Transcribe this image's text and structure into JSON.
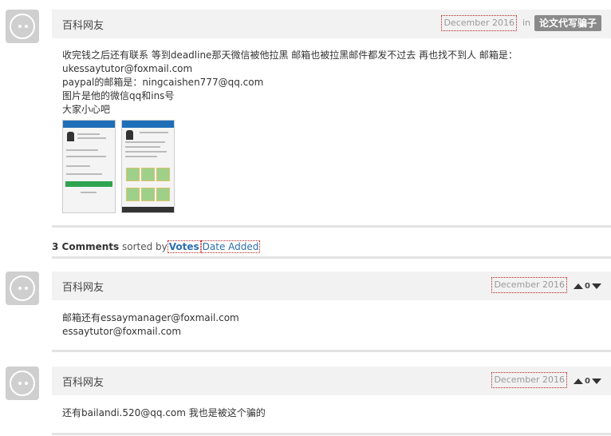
{
  "post": {
    "author": "百科网友",
    "date": "December 2016",
    "in_label": "in",
    "category": "论文代写骗子",
    "body_lines": [
      "收完钱之后还有联系 等到deadline那天微信被他拉黑 邮箱也被拉黑邮件都发不过去 再也找不到人 邮箱是：",
      "ukessaytutor@foxmail.com",
      "paypal的邮箱是：ningcaishen777@qq.com",
      "图片是他的微信qq和ins号",
      "大家小心吧"
    ]
  },
  "comments_header": {
    "count_label": "3 Comments",
    "sorted_by": "sorted by",
    "sort_votes": "Votes",
    "sort_date": "Date Added"
  },
  "comments": [
    {
      "author": "百科网友",
      "date": "December 2016",
      "votes": "0",
      "body_lines": [
        "邮箱还有essaymanager@foxmail.com",
        "essaytutor@foxmail.com"
      ]
    },
    {
      "author": "百科网友",
      "date": "December 2016",
      "votes": "0",
      "body_lines": [
        "还有bailandi.520@qq.com 我也是被这个骗的"
      ]
    }
  ],
  "colors": {
    "header_bg": "#f2f2f2",
    "tag_bg": "#8a8a8a",
    "link": "#2a6fb0",
    "avatar_bg": "#cfcfcf"
  }
}
